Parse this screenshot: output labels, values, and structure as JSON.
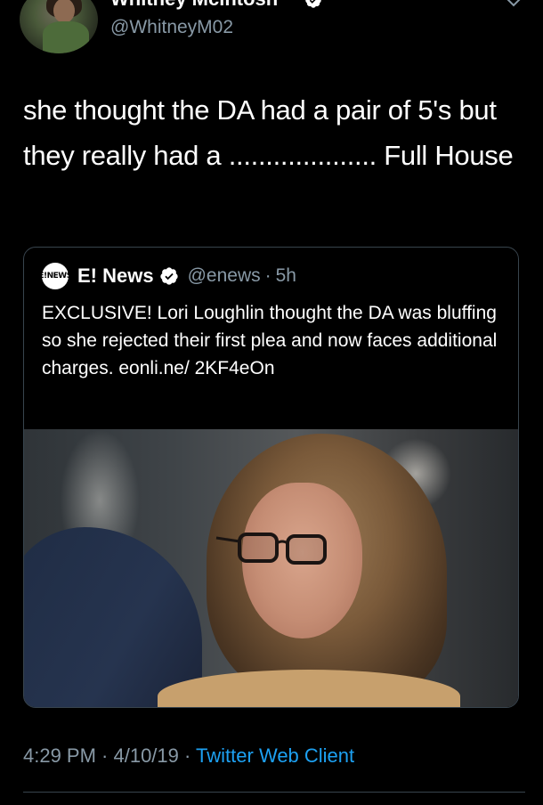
{
  "tweet": {
    "author": {
      "display_name": "Whitney Mcintosh",
      "handle": "@WhitneyM02",
      "verified": true
    },
    "text": "she thought the DA had a pair of 5's but they really had a .................... Full House",
    "timestamp": "4:29 PM · 4/10/19 · ",
    "client": "Twitter Web Client"
  },
  "quoted_tweet": {
    "logo_text": "E!NEWS",
    "display_name": "E! News",
    "handle": "@enews",
    "separator": "·",
    "age": "5h",
    "text": "EXCLUSIVE! Lori Loughlin thought the DA was bluffing so she rejected their first plea and now faces additional charges. eonli.ne/ 2KF4eOn",
    "media": "photo"
  },
  "icons": {
    "verified": "verified-badge-icon",
    "more": "chevron-down-icon"
  },
  "colors": {
    "background": "#000000",
    "text": "#ffffff",
    "secondary": "#8899a6",
    "link": "#1da1f2",
    "border": "#38444d"
  }
}
